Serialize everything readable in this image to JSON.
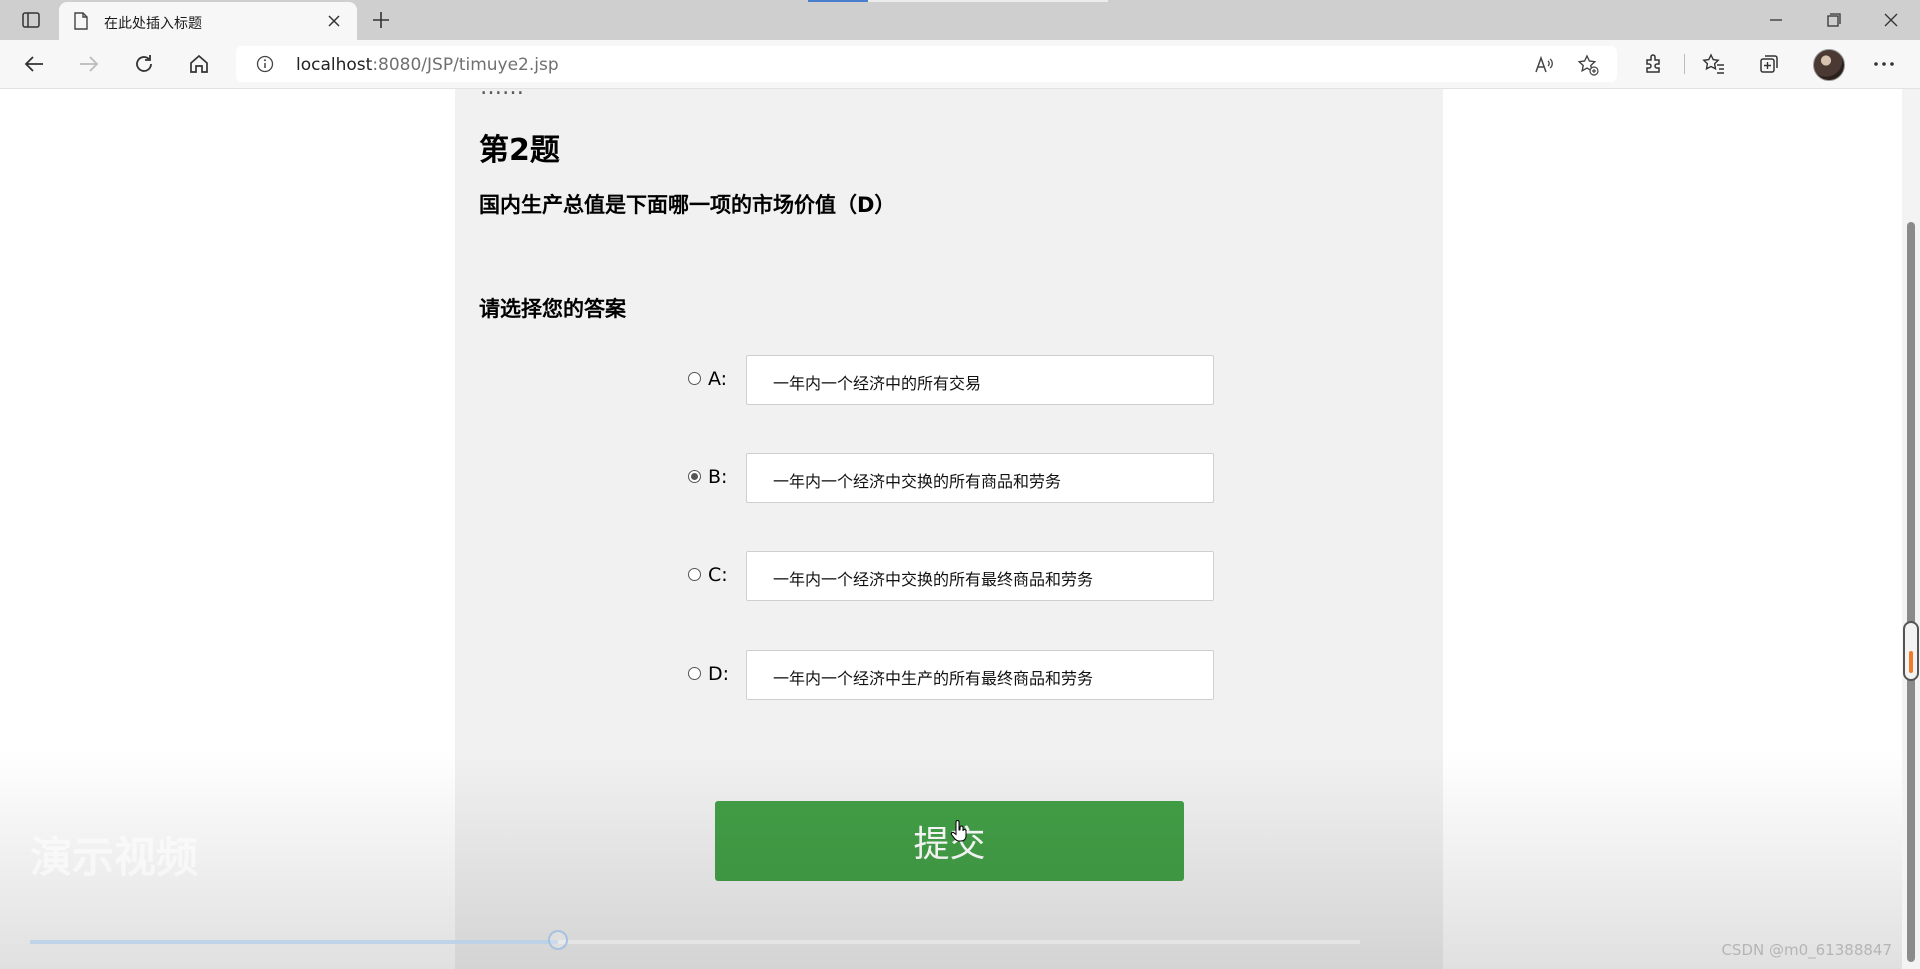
{
  "browser": {
    "tab_title": "在此处插入标题",
    "url_host": "localhost",
    "url_path": ":8080/JSP/timuye2.jsp"
  },
  "page": {
    "cut_heading": "……",
    "question_number": "第2题",
    "question_text": "国内生产总值是下面哪一项的市场价值（D）",
    "answer_prompt": "请选择您的答案",
    "options": [
      {
        "letter": "A:",
        "text": "一年内一个经济中的所有交易",
        "selected": false
      },
      {
        "letter": "B:",
        "text": "一年内一个经济中交换的所有商品和劳务",
        "selected": true
      },
      {
        "letter": "C:",
        "text": "一年内一个经济中交换的所有最终商品和劳务",
        "selected": false
      },
      {
        "letter": "D:",
        "text": "一年内一个经济中生产的所有最终商品和劳务",
        "selected": false
      }
    ],
    "submit_label": "提交"
  },
  "overlay": {
    "watermark": "演示视频",
    "csdn": "CSDN @m0_61388847",
    "seek_progress": 0.397
  },
  "colors": {
    "submit_bg": "#43a047",
    "panel_bg": "#f1f1f1"
  }
}
